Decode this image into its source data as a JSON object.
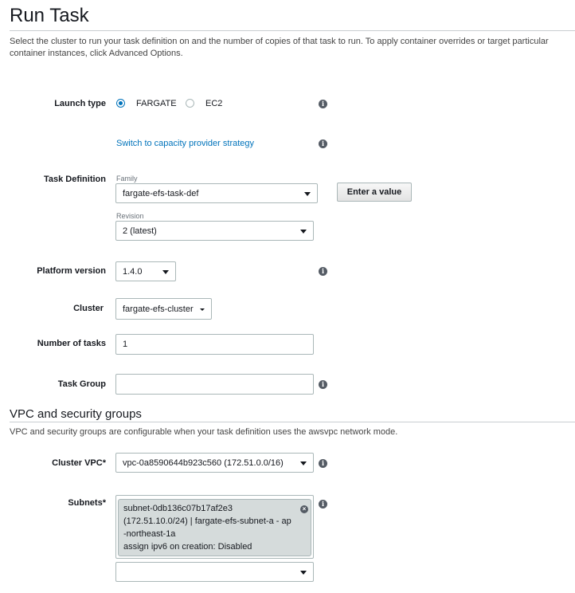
{
  "page": {
    "title": "Run Task",
    "description": "Select the cluster to run your task definition on and the number of copies of that task to run. To apply container overrides or target particular container instances, click Advanced Options."
  },
  "launch_type": {
    "label": "Launch type",
    "options": [
      "FARGATE",
      "EC2"
    ],
    "selected": "FARGATE"
  },
  "capacity_link": "Switch to capacity provider strategy",
  "task_definition": {
    "label": "Task Definition",
    "family_label": "Family",
    "family_value": "fargate-efs-task-def",
    "enter_value_button": "Enter a value",
    "revision_label": "Revision",
    "revision_value": "2 (latest)"
  },
  "platform_version": {
    "label": "Platform version",
    "value": "1.4.0"
  },
  "cluster": {
    "label": "Cluster",
    "value": "fargate-efs-cluster"
  },
  "number_of_tasks": {
    "label": "Number of tasks",
    "value": "1"
  },
  "task_group": {
    "label": "Task Group",
    "value": ""
  },
  "vpc_section": {
    "title": "VPC and security groups",
    "description": "VPC and security groups are configurable when your task definition uses the awsvpc network mode."
  },
  "cluster_vpc": {
    "label": "Cluster VPC*",
    "value": "vpc-0a8590644b923c560 (172.51.0.0/16)"
  },
  "subnets": {
    "label": "Subnets*",
    "chip_lines": [
      "subnet-0db136c07b17af2e3",
      "(172.51.10.0/24) | fargate-efs-subnet-a - ap",
      "-northeast-1a",
      "assign ipv6 on creation: Disabled"
    ],
    "select_value": ""
  },
  "icons": {
    "info": "info-icon",
    "remove": "remove-icon",
    "dropdown": "caret-down-icon"
  }
}
